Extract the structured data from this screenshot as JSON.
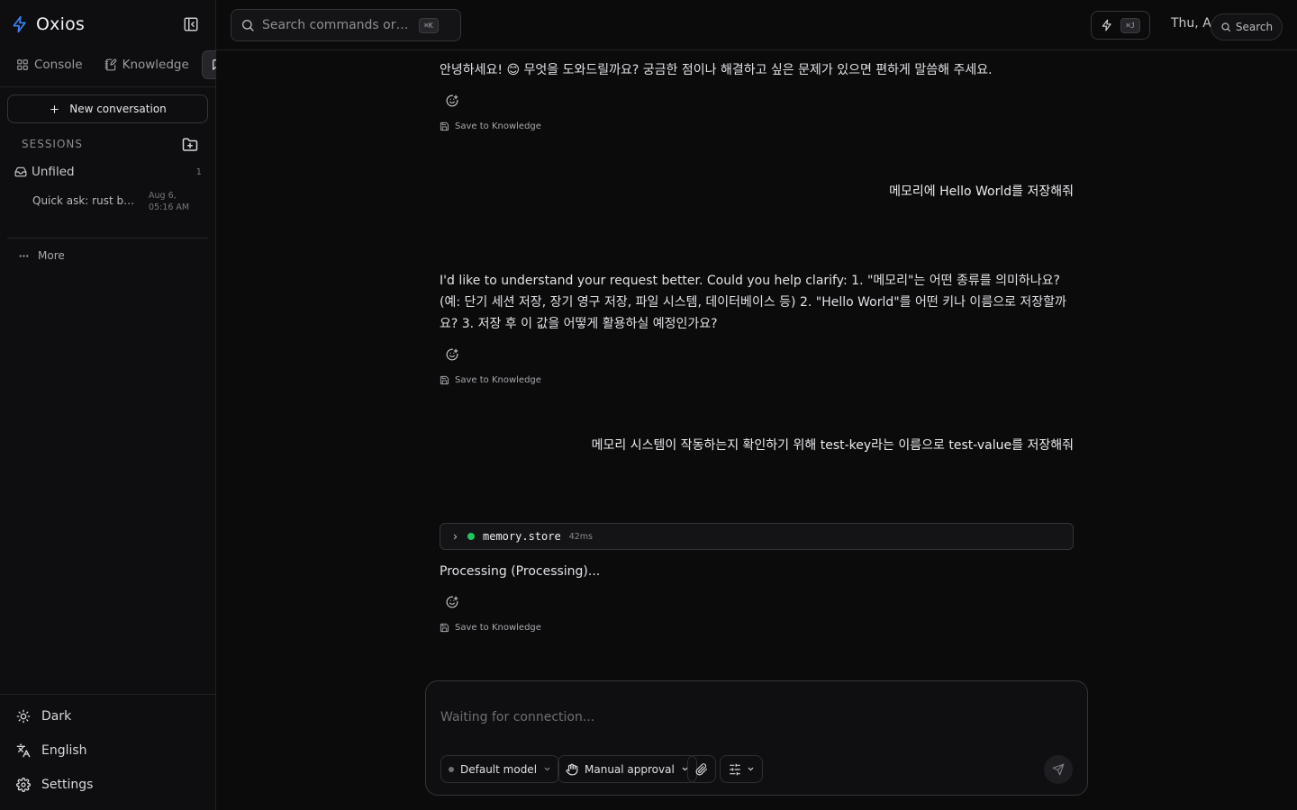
{
  "app": {
    "name": "Oxios"
  },
  "nav_tabs": [
    {
      "label": "Console",
      "icon": "grid-icon"
    },
    {
      "label": "Knowledge",
      "icon": "notebook-pen-icon"
    },
    {
      "label": "",
      "icon": "chat-icon"
    }
  ],
  "sidebar": {
    "new_conversation": "New conversation",
    "sessions_label": "SESSIONS",
    "folder": {
      "label": "Unfiled",
      "count": "1"
    },
    "session": {
      "title": "Quick ask: rust borro…",
      "time": "Aug 6, 05:16 AM"
    },
    "more": "More",
    "bottom": {
      "theme": "Dark",
      "language": "English",
      "settings": "Settings"
    }
  },
  "topbar": {
    "search_placeholder": "Search commands or type …",
    "search_shortcut": "⌘K",
    "quick_shortcut": "⌘J",
    "date": "Thu, Au",
    "search_button": "Search"
  },
  "messages": {
    "a1": "안녕하세요! 😊 무엇을 도와드릴까요? 궁금한 점이나 해결하고 싶은 문제가 있으면 편하게 말씀해 주세요.",
    "u1": "메모리에 Hello World를 저장해줘",
    "a2": "I'd like to understand your request better. Could you help clarify: 1. \"메모리\"는 어떤 종류를 의미하나요? (예: 단기 세션 저장, 장기 영구 저장, 파일 시스템, 데이터베이스 등) 2. \"Hello World\"를 어떤 키나 이름으로 저장할까요? 3. 저장 후 이 값을 어떻게 활용하실 예정인가요?",
    "u2": "메모리 시스템이 작동하는지 확인하기 위해 test-key라는 이름으로 test-value를 저장해줘",
    "tool": {
      "name": "memory.store",
      "duration": "42ms",
      "status_color": "#22c55e"
    },
    "a3": "Processing (Processing)...",
    "save_label": "Save to Knowledge"
  },
  "composer": {
    "placeholder": "Waiting for connection...",
    "model": "Default model",
    "approval": "Manual approval"
  },
  "colors": {
    "accent": "#3b82f6",
    "success": "#22c55e",
    "background": "#0b0b0c"
  }
}
